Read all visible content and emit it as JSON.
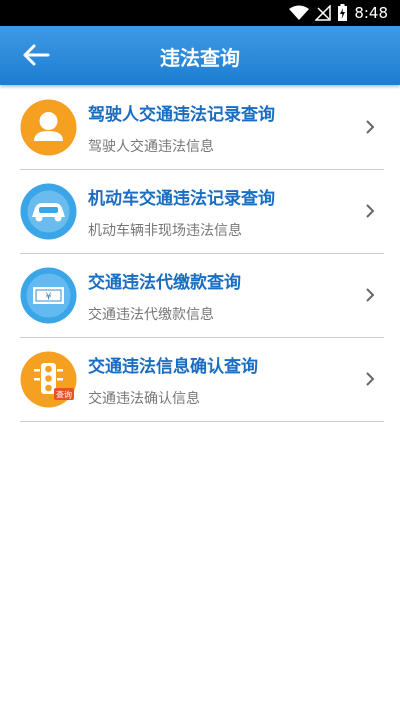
{
  "status": {
    "time": "8:48"
  },
  "header": {
    "title": "违法查询"
  },
  "items": [
    {
      "title": "驾驶人交通违法记录查询",
      "subtitle": "驾驶人交通违法信息",
      "icon": "driver-icon"
    },
    {
      "title": "机动车交通违法记录查询",
      "subtitle": "机动车辆非现场违法信息",
      "icon": "car-icon"
    },
    {
      "title": "交通违法代缴款查询",
      "subtitle": "交通违法代缴款信息",
      "icon": "money-icon"
    },
    {
      "title": "交通违法信息确认查询",
      "subtitle": "交通违法确认信息",
      "icon": "traffic-light-icon",
      "badge": "查询"
    }
  ]
}
